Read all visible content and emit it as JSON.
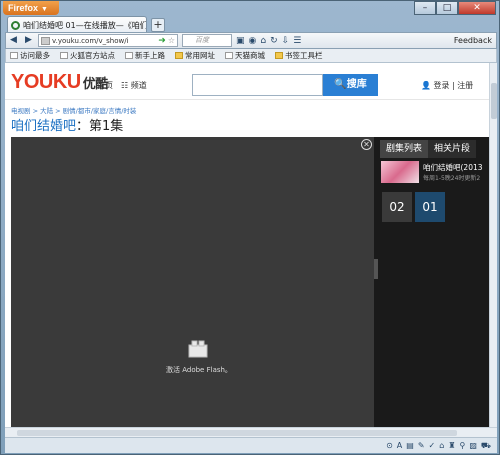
{
  "browser": {
    "app_button": "Firefox",
    "tab_title": "咱们结婚吧 01—在线播放—《咱们结婚",
    "url": "v.youku.com/v_show/i",
    "search_placeholder": "百度",
    "feedback": "Feedback"
  },
  "bookmarks": [
    {
      "label": "访问最多",
      "icon": "gear-icon"
    },
    {
      "label": "火狐官方站点",
      "icon": "page-icon"
    },
    {
      "label": "新手上路",
      "icon": "page-icon"
    },
    {
      "label": "常用网址",
      "icon": "folder-icon"
    },
    {
      "label": "天猫商城",
      "icon": "page-icon"
    },
    {
      "label": "书签工具栏",
      "icon": "folder-icon"
    }
  ],
  "youku": {
    "logo": "YOUKU",
    "logo_cn": "优酷",
    "nav_home": "首页",
    "nav_channels": "频道",
    "search_button": "搜库",
    "login": "登录",
    "register": "注册",
    "breadcrumb": "电视剧 > 大陆 > 剧情/都市/家庭/言情/时装",
    "title": "咱们结婚吧",
    "episode": "：第1集"
  },
  "player": {
    "flash_prompt": "激活 Adobe Flash。"
  },
  "sidebar": {
    "tabs": [
      "剧集列表",
      "相关片段"
    ],
    "item_title": "咱们结婚吧(2013",
    "item_subtitle": "每周1-5晚24时更新2",
    "episodes": [
      "02",
      "01"
    ]
  }
}
